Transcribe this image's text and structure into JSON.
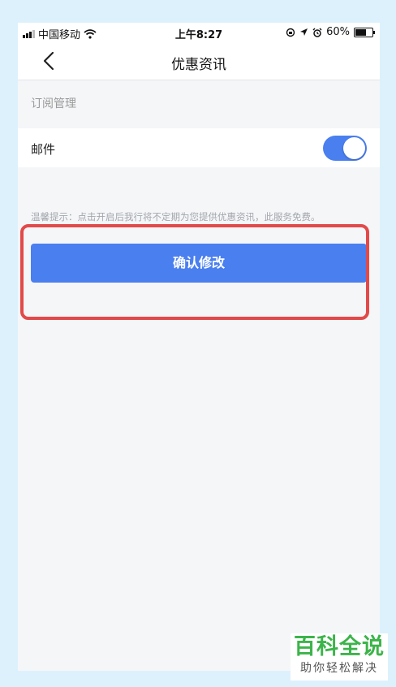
{
  "status_bar": {
    "carrier": "中国移动",
    "time": "上午8:27",
    "battery": "60%",
    "icons": [
      "signal-icon",
      "wifi-icon",
      "orientation-lock-icon",
      "location-icon",
      "alarm-icon",
      "battery-icon"
    ]
  },
  "nav": {
    "title": "优惠资讯",
    "back_icon": "chevron-left-icon"
  },
  "section": {
    "label": "订阅管理"
  },
  "row": {
    "label": "邮件",
    "toggle_on": true
  },
  "tip": "温馨提示：点击开启后我行将不定期为您提供优惠资讯，此服务免费。",
  "confirm_button": "确认修改",
  "watermark": {
    "title": "百科全说",
    "subtitle": "助你轻松解决"
  },
  "colors": {
    "accent": "#4a7ff0",
    "highlight": "#e24a4a",
    "watermark_green": "#3cb44a",
    "background": "#ddf1fd"
  }
}
